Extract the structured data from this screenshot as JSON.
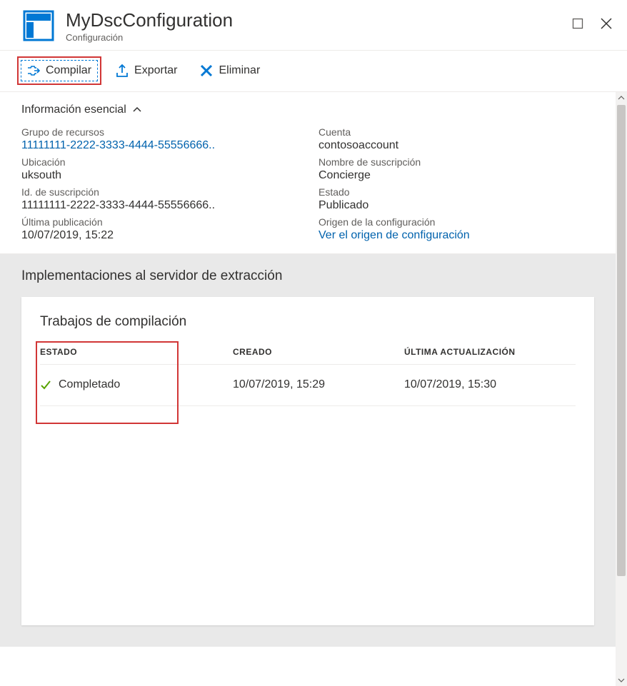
{
  "header": {
    "title": "MyDscConfiguration",
    "subtitle": "Configuración"
  },
  "toolbar": {
    "compile": "Compilar",
    "export": "Exportar",
    "delete": "Eliminar"
  },
  "essentials": {
    "heading": "Información esencial",
    "left": [
      {
        "label": "Grupo de recursos",
        "value": "11111111-2222-3333-4444-55556666..",
        "link": true
      },
      {
        "label": "Ubicación",
        "value": "uksouth",
        "link": false
      },
      {
        "label": "Id. de suscripción",
        "value": "11111111-2222-3333-4444-55556666..",
        "link": false
      },
      {
        "label": "Última publicación",
        "value": "10/07/2019, 15:22",
        "link": false
      }
    ],
    "right": [
      {
        "label": "Cuenta",
        "value": "contosoaccount",
        "link": false
      },
      {
        "label": "Nombre de suscripción",
        "value": "Concierge",
        "link": false
      },
      {
        "label": "Estado",
        "value": "Publicado",
        "link": false
      },
      {
        "label": "Origen de la configuración",
        "value": "Ver el origen de configuración",
        "link": true
      }
    ]
  },
  "pullServer": {
    "heading": "Implementaciones al servidor de extracción",
    "cardHeading": "Trabajos de compilación",
    "columns": {
      "status": "ESTADO",
      "created": "CREADO",
      "updated": "ÚLTIMA ACTUALIZACIÓN"
    },
    "rows": [
      {
        "status": "Completado",
        "created": "10/07/2019, 15:29",
        "updated": "10/07/2019, 15:30"
      }
    ]
  }
}
